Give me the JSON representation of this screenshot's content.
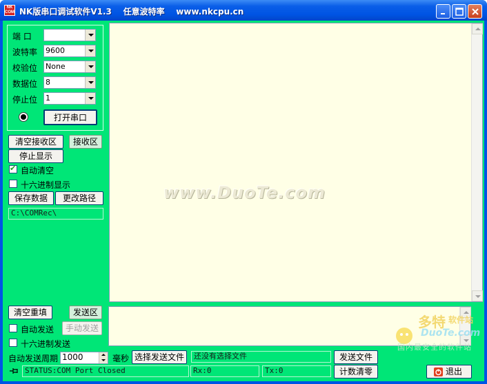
{
  "window": {
    "title": "NK版串口调试软件V1.3    任意波特率    www.nkcpu.cn",
    "icon_text": "NK COM"
  },
  "settings": {
    "port_label": "端  口",
    "port_value": "",
    "baud_label": "波特率",
    "baud_value": "9600",
    "parity_label": "校验位",
    "parity_value": "None",
    "databits_label": "数据位",
    "databits_value": "8",
    "stopbits_label": "停止位",
    "stopbits_value": "1",
    "open_port_label": "打开串口"
  },
  "receive": {
    "clear_label": "清空接收区",
    "area_label": "接收区",
    "stop_display_label": "停止显示",
    "auto_clear_label": "自动清空",
    "auto_clear_checked": true,
    "hex_display_label": "十六进制显示",
    "hex_display_checked": false,
    "save_data_label": "保存数据",
    "change_path_label": "更改路径",
    "path_value": "C:\\COMRec\\",
    "watermark": "www.DuoTe.com"
  },
  "send": {
    "clear_label": "清空重填",
    "area_label": "发送区",
    "auto_send_label": "自动发送",
    "auto_send_checked": false,
    "manual_send_label": "手动发送",
    "hex_send_label": "十六进制发送",
    "hex_send_checked": false,
    "period_label": "自动发送周期",
    "period_value": "1000",
    "ms_label": "毫秒",
    "choose_file_label": "选择发送文件",
    "file_status": "还没有选择文件",
    "send_file_label": "发送文件",
    "reset_count_label": "计数清零",
    "exit_label": "退出"
  },
  "status": {
    "port_status": "STATUS:COM Port Closed",
    "rx": "Rx:0",
    "tx": "Tx:0"
  },
  "brand": {
    "name": "多特",
    "suffix": "软件站",
    "url": "DuoTe.com",
    "slogan": "国内最安全的软件站"
  },
  "colors": {
    "client_bg": "#00e677",
    "text_area_bg": "#ffffe6",
    "titlebar": "#0054e3"
  }
}
